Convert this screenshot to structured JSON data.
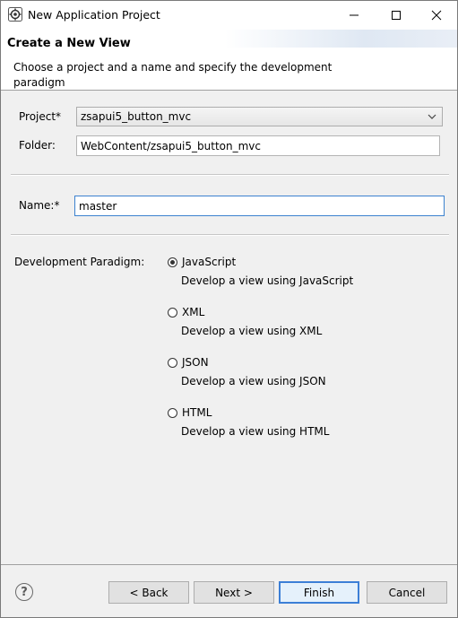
{
  "window": {
    "title": "New Application Project",
    "icon": "eclipse-gear-icon"
  },
  "header": {
    "title": "Create a New View",
    "description": "Choose a project and a name and specify the development paradigm"
  },
  "form": {
    "project_label": "Project*",
    "project_value": "zsapui5_button_mvc",
    "folder_label": "Folder:",
    "folder_value": "WebContent/zsapui5_button_mvc",
    "name_label": "Name:*",
    "name_value": "master",
    "paradigm_label": "Development Paradigm:",
    "paradigms": [
      {
        "label": "JavaScript",
        "description": "Develop a view using JavaScript",
        "selected": true
      },
      {
        "label": "XML",
        "description": "Develop a view using XML",
        "selected": false
      },
      {
        "label": "JSON",
        "description": "Develop a view using JSON",
        "selected": false
      },
      {
        "label": "HTML",
        "description": "Develop a view using HTML",
        "selected": false
      }
    ]
  },
  "buttons": {
    "help": "?",
    "back": "< Back",
    "next": "Next >",
    "finish": "Finish",
    "cancel": "Cancel"
  },
  "colors": {
    "accent": "#3c7fd6",
    "background": "#f0f0f0"
  }
}
